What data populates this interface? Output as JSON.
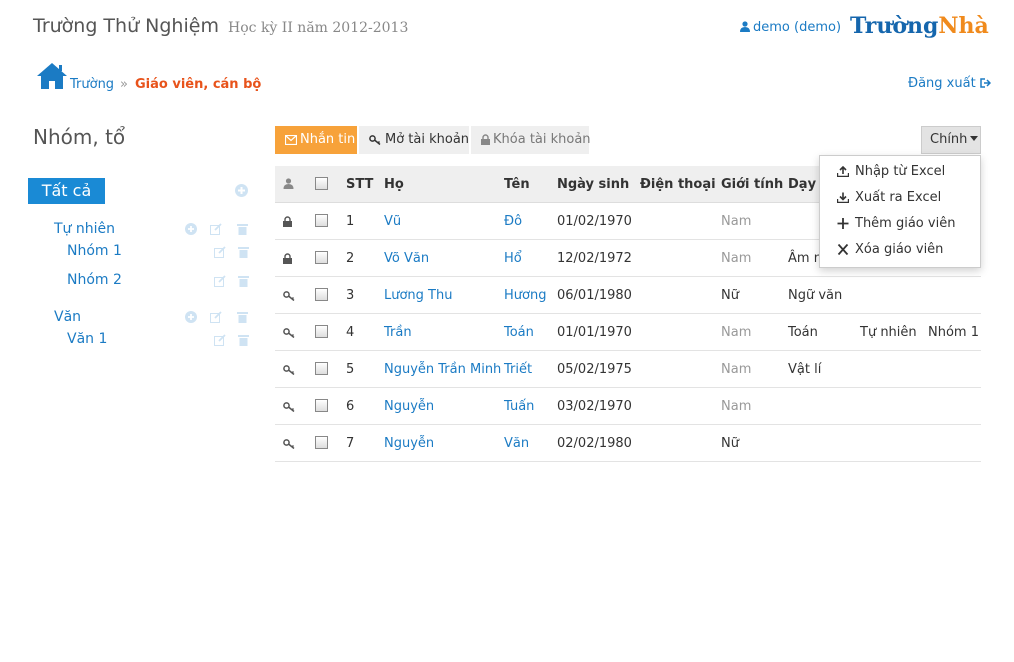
{
  "header": {
    "school_name": "Trường Thử Nghiệm",
    "semester": "Học kỳ II năm 2012-2013",
    "user": "demo (demo)",
    "logo_part1": "Trường",
    "logo_part2": "Nhà"
  },
  "breadcrumb": {
    "home": "Trường",
    "separator": "»",
    "current": "Giáo viên, cán bộ"
  },
  "logout": "Đăng xuất",
  "sidebar": {
    "title": "Nhóm, tổ",
    "all": "Tất cả",
    "groups": [
      {
        "label": "Tự nhiên",
        "children": [
          "Nhóm 1",
          "Nhóm 2"
        ]
      },
      {
        "label": "Văn",
        "children": [
          "Văn 1"
        ]
      }
    ]
  },
  "toolbar": {
    "message": "Nhắn tin",
    "open_account": "Mở tài khoản",
    "lock_account": "Khóa tài khoản",
    "more": "Chính"
  },
  "menu": {
    "items": [
      "Nhập từ Excel",
      "Xuất ra Excel",
      "Thêm giáo viên",
      "Xóa giáo viên"
    ]
  },
  "table": {
    "headers": [
      "STT",
      "Họ",
      "Tên",
      "Ngày sinh",
      "Điện thoại",
      "Giới tính",
      "Dạy m"
    ],
    "rows": [
      {
        "status": "locked",
        "stt": "1",
        "ho": "Vũ",
        "ten": "Đô",
        "ngay_sinh": "01/02/1970",
        "dien_thoai": "",
        "gioi_tinh": "Nam",
        "day": "",
        "col2": "",
        "col3": ""
      },
      {
        "status": "locked",
        "stt": "2",
        "ho": "Võ Văn",
        "ten": "Hổ",
        "ngay_sinh": "12/02/1972",
        "dien_thoai": "",
        "gioi_tinh": "Nam",
        "day": "Âm n",
        "col2": "",
        "col3": ""
      },
      {
        "status": "open",
        "stt": "3",
        "ho": "Lương Thu",
        "ten": "Hương",
        "ngay_sinh": "06/01/1980",
        "dien_thoai": "",
        "gioi_tinh": "Nữ",
        "day": "Ngữ văn",
        "col2": "",
        "col3": ""
      },
      {
        "status": "open",
        "stt": "4",
        "ho": "Trần",
        "ten": "Toán",
        "ngay_sinh": "01/01/1970",
        "dien_thoai": "",
        "gioi_tinh": "Nam",
        "day": "Toán",
        "col2": "Tự nhiên",
        "col3": "Nhóm 1"
      },
      {
        "status": "open",
        "stt": "5",
        "ho": "Nguyễn Trần Minh",
        "ten": "Triết",
        "ngay_sinh": "05/02/1975",
        "dien_thoai": "",
        "gioi_tinh": "Nam",
        "day": "Vật lí",
        "col2": "",
        "col3": ""
      },
      {
        "status": "open",
        "stt": "6",
        "ho": "Nguyễn",
        "ten": "Tuấn",
        "ngay_sinh": "03/02/1970",
        "dien_thoai": "",
        "gioi_tinh": "Nam",
        "day": "",
        "col2": "",
        "col3": ""
      },
      {
        "status": "open",
        "stt": "7",
        "ho": "Nguyễn",
        "ten": "Văn",
        "ngay_sinh": "02/02/1980",
        "dien_thoai": "",
        "gioi_tinh": "Nữ",
        "day": "",
        "col2": "",
        "col3": ""
      }
    ]
  },
  "colors": {
    "accent_blue": "#1a8ad5",
    "link_blue": "#1b7bc4",
    "orange": "#f7a23a",
    "breadcrumb_current": "#e8531b"
  },
  "icons": {
    "user": "user-icon",
    "home": "home-icon",
    "logout": "sign-out-icon",
    "add": "plus-circle-icon",
    "edit": "edit-icon",
    "delete": "trash-icon",
    "message": "envelope-icon",
    "key": "key-icon",
    "lock": "lock-icon"
  }
}
